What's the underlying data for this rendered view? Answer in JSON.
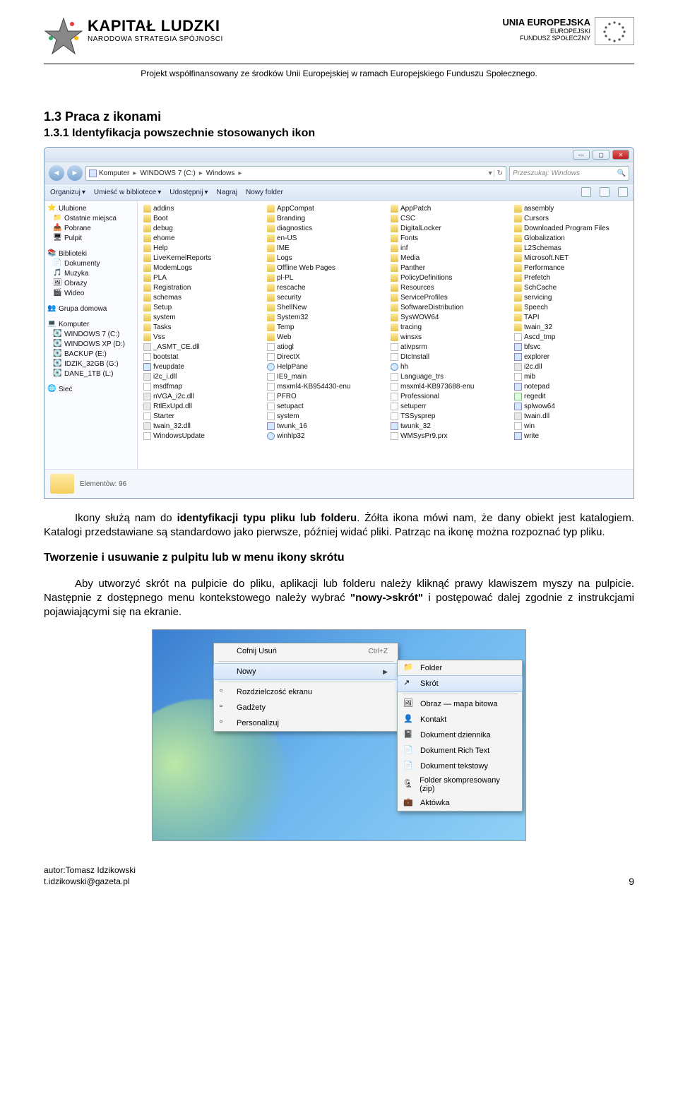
{
  "header": {
    "left": {
      "title": "KAPITAŁ LUDZKI",
      "sub": "NARODOWA STRATEGIA SPÓJNOŚCI"
    },
    "right": {
      "title": "UNIA EUROPEJSKA",
      "sub1": "EUROPEJSKI",
      "sub2": "FUNDUSZ SPOŁECZNY"
    },
    "project_line": "Projekt współfinansowany ze środków Unii Europejskiej w ramach Europejskiego Funduszu Społecznego."
  },
  "section": {
    "title": "1.3 Praca z ikonami",
    "sub": "1.3.1 Identyfikacja powszechnie stosowanych ikon"
  },
  "explorer": {
    "breadcrumb": [
      "Komputer",
      "WINDOWS 7 (C:)",
      "Windows"
    ],
    "search_placeholder": "Przeszukaj: Windows",
    "toolbar": [
      "Organizuj",
      "Umieść w bibliotece",
      "Udostępnij",
      "Nagraj",
      "Nowy folder"
    ],
    "sidebar": [
      {
        "label": "Ulubione",
        "root": true,
        "ic": "star"
      },
      {
        "label": "Ostatnie miejsca",
        "ic": "place"
      },
      {
        "label": "Pobrane",
        "ic": "dl"
      },
      {
        "label": "Pulpit",
        "ic": "desk"
      },
      {
        "sep": true
      },
      {
        "label": "Biblioteki",
        "root": true,
        "ic": "lib"
      },
      {
        "label": "Dokumenty",
        "ic": "doc"
      },
      {
        "label": "Muzyka",
        "ic": "mus"
      },
      {
        "label": "Obrazy",
        "ic": "img"
      },
      {
        "label": "Wideo",
        "ic": "vid"
      },
      {
        "sep": true
      },
      {
        "label": "Grupa domowa",
        "root": true,
        "ic": "hg"
      },
      {
        "sep": true
      },
      {
        "label": "Komputer",
        "root": true,
        "ic": "pc"
      },
      {
        "label": "WINDOWS 7 (C:)",
        "ic": "drv"
      },
      {
        "label": "WINDOWS XP (D:)",
        "ic": "drv"
      },
      {
        "label": "BACKUP (E:)",
        "ic": "drv"
      },
      {
        "label": "IDZIK_32GB (G:)",
        "ic": "drv"
      },
      {
        "label": "DANE_1TB (L:)",
        "ic": "drv"
      },
      {
        "sep": true
      },
      {
        "label": "Sieć",
        "root": true,
        "ic": "net"
      }
    ],
    "columns": [
      [
        {
          "n": "addins",
          "t": "folder"
        },
        {
          "n": "Boot",
          "t": "folder"
        },
        {
          "n": "debug",
          "t": "folder"
        },
        {
          "n": "ehome",
          "t": "folder"
        },
        {
          "n": "Help",
          "t": "folder"
        },
        {
          "n": "LiveKernelReports",
          "t": "folder"
        },
        {
          "n": "ModemLogs",
          "t": "folder"
        },
        {
          "n": "PLA",
          "t": "folder"
        },
        {
          "n": "Registration",
          "t": "folder"
        },
        {
          "n": "schemas",
          "t": "folder"
        },
        {
          "n": "Setup",
          "t": "folder"
        },
        {
          "n": "system",
          "t": "folder"
        },
        {
          "n": "Tasks",
          "t": "folder"
        },
        {
          "n": "Vss",
          "t": "folder"
        },
        {
          "n": "_ASMT_CE.dll",
          "t": "dll"
        },
        {
          "n": "bootstat",
          "t": "file"
        },
        {
          "n": "fveupdate",
          "t": "exe"
        },
        {
          "n": "i2c_i.dll",
          "t": "dll"
        },
        {
          "n": "msdfmap",
          "t": "file"
        },
        {
          "n": "nVGA_i2c.dll",
          "t": "dll"
        },
        {
          "n": "RtlExUpd.dll",
          "t": "dll"
        },
        {
          "n": "Starter",
          "t": "file"
        },
        {
          "n": "twain_32.dll",
          "t": "dll"
        },
        {
          "n": "WindowsUpdate",
          "t": "file"
        }
      ],
      [
        {
          "n": "AppCompat",
          "t": "folder"
        },
        {
          "n": "Branding",
          "t": "folder"
        },
        {
          "n": "diagnostics",
          "t": "folder"
        },
        {
          "n": "en-US",
          "t": "folder"
        },
        {
          "n": "IME",
          "t": "folder"
        },
        {
          "n": "Logs",
          "t": "folder"
        },
        {
          "n": "Offline Web Pages",
          "t": "folder"
        },
        {
          "n": "pl-PL",
          "t": "folder"
        },
        {
          "n": "rescache",
          "t": "folder"
        },
        {
          "n": "security",
          "t": "folder"
        },
        {
          "n": "ShellNew",
          "t": "folder"
        },
        {
          "n": "System32",
          "t": "folder"
        },
        {
          "n": "Temp",
          "t": "folder"
        },
        {
          "n": "Web",
          "t": "folder"
        },
        {
          "n": "atiogl",
          "t": "file"
        },
        {
          "n": "DirectX",
          "t": "file"
        },
        {
          "n": "HelpPane",
          "t": "help"
        },
        {
          "n": "IE9_main",
          "t": "file"
        },
        {
          "n": "msxml4-KB954430-enu",
          "t": "file"
        },
        {
          "n": "PFRO",
          "t": "file"
        },
        {
          "n": "setupact",
          "t": "file"
        },
        {
          "n": "system",
          "t": "file"
        },
        {
          "n": "twunk_16",
          "t": "exe"
        },
        {
          "n": "winhlp32",
          "t": "help"
        }
      ],
      [
        {
          "n": "AppPatch",
          "t": "folder"
        },
        {
          "n": "CSC",
          "t": "folder"
        },
        {
          "n": "DigitalLocker",
          "t": "folder"
        },
        {
          "n": "Fonts",
          "t": "folder"
        },
        {
          "n": "inf",
          "t": "folder"
        },
        {
          "n": "Media",
          "t": "folder"
        },
        {
          "n": "Panther",
          "t": "folder"
        },
        {
          "n": "PolicyDefinitions",
          "t": "folder"
        },
        {
          "n": "Resources",
          "t": "folder"
        },
        {
          "n": "ServiceProfiles",
          "t": "folder"
        },
        {
          "n": "SoftwareDistribution",
          "t": "folder"
        },
        {
          "n": "SysWOW64",
          "t": "folder"
        },
        {
          "n": "tracing",
          "t": "folder"
        },
        {
          "n": "winsxs",
          "t": "folder"
        },
        {
          "n": "ativpsrm",
          "t": "file"
        },
        {
          "n": "DtcInstall",
          "t": "file"
        },
        {
          "n": "hh",
          "t": "help"
        },
        {
          "n": "Language_trs",
          "t": "file"
        },
        {
          "n": "msxml4-KB973688-enu",
          "t": "file"
        },
        {
          "n": "Professional",
          "t": "file"
        },
        {
          "n": "setuperr",
          "t": "file"
        },
        {
          "n": "TSSysprep",
          "t": "file"
        },
        {
          "n": "twunk_32",
          "t": "exe"
        },
        {
          "n": "WMSysPr9.prx",
          "t": "file"
        }
      ],
      [
        {
          "n": "assembly",
          "t": "folder"
        },
        {
          "n": "Cursors",
          "t": "folder"
        },
        {
          "n": "Downloaded Program Files",
          "t": "folder"
        },
        {
          "n": "Globalization",
          "t": "folder"
        },
        {
          "n": "L2Schemas",
          "t": "folder"
        },
        {
          "n": "Microsoft.NET",
          "t": "folder"
        },
        {
          "n": "Performance",
          "t": "folder"
        },
        {
          "n": "Prefetch",
          "t": "folder"
        },
        {
          "n": "SchCache",
          "t": "folder"
        },
        {
          "n": "servicing",
          "t": "folder"
        },
        {
          "n": "Speech",
          "t": "folder"
        },
        {
          "n": "TAPI",
          "t": "folder"
        },
        {
          "n": "twain_32",
          "t": "folder"
        },
        {
          "n": "Ascd_tmp",
          "t": "file"
        },
        {
          "n": "bfsvc",
          "t": "exe"
        },
        {
          "n": "explorer",
          "t": "exe"
        },
        {
          "n": "i2c.dll",
          "t": "dll"
        },
        {
          "n": "mib",
          "t": "file"
        },
        {
          "n": "notepad",
          "t": "exe"
        },
        {
          "n": "regedit",
          "t": "reg"
        },
        {
          "n": "splwow64",
          "t": "exe"
        },
        {
          "n": "twain.dll",
          "t": "dll"
        },
        {
          "n": "win",
          "t": "file"
        },
        {
          "n": "write",
          "t": "exe"
        }
      ]
    ],
    "status": "Elementów: 96"
  },
  "paragraph1": "Ikony służą nam do <b>identyfikacji typu pliku lub folderu</b>. Żółta ikona mówi nam, że dany obiekt jest katalogiem. Katalogi przedstawiane są standardowo jako pierwsze, później widać pliki. Patrząc na ikonę można rozpoznać typ pliku.",
  "subhead": "Tworzenie i usuwanie z pulpitu lub w menu ikony skrótu",
  "paragraph2": "Aby utworzyć skrót na pulpicie do pliku, aplikacji lub folderu należy kliknąć prawy klawiszem myszy na pulpicie. Następnie z dostępnego menu kontekstowego należy wybrać <b>\"nowy->skrót\"</b> i postępować dalej zgodnie z instrukcjami pojawiającymi się na ekranie.",
  "context_menu": {
    "left": [
      {
        "label": "Cofnij Usuń",
        "right": "Ctrl+Z"
      },
      {
        "sep": true
      },
      {
        "label": "Nowy",
        "selected": true,
        "submenu": true
      },
      {
        "sep": true
      },
      {
        "label": "Rozdzielczość ekranu",
        "icon": true
      },
      {
        "label": "Gadżety",
        "icon": true
      },
      {
        "label": "Personalizuj",
        "icon": true
      }
    ],
    "right": [
      {
        "label": "Folder",
        "ic": "folder"
      },
      {
        "label": "Skrót",
        "ic": "shortcut",
        "selected": true
      },
      {
        "sep": true
      },
      {
        "label": "Obraz — mapa bitowa",
        "ic": "bmp"
      },
      {
        "label": "Kontakt",
        "ic": "contact"
      },
      {
        "label": "Dokument dziennika",
        "ic": "journal"
      },
      {
        "label": "Dokument Rich Text",
        "ic": "rtf"
      },
      {
        "label": "Dokument tekstowy",
        "ic": "txt"
      },
      {
        "label": "Folder skompresowany (zip)",
        "ic": "zip"
      },
      {
        "label": "Aktówka",
        "ic": "brief"
      }
    ]
  },
  "footer": {
    "author1": "autor:Tomasz Idzikowski",
    "author2": "t.idzikowski@gazeta.pl",
    "page": "9"
  }
}
